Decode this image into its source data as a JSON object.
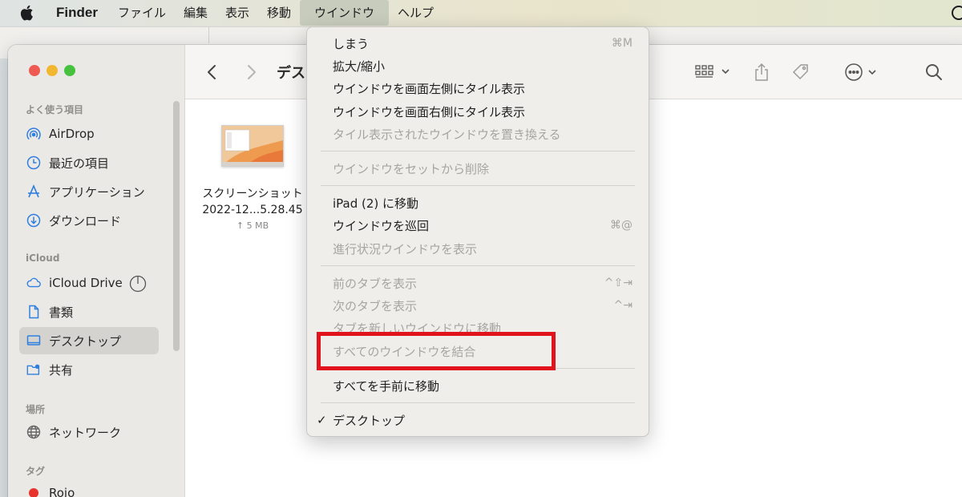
{
  "menubar": {
    "app_name": "Finder",
    "items": [
      "ファイル",
      "編集",
      "表示",
      "移動",
      "ウインドウ",
      "ヘルプ"
    ]
  },
  "toolbar": {
    "title": "デス"
  },
  "sidebar": {
    "favorites_label": "よく使う項目",
    "favorites": [
      "AirDrop",
      "最近の項目",
      "アプリケーション",
      "ダウンロード"
    ],
    "icloud_label": "iCloud",
    "icloud": [
      "iCloud Drive",
      "書類",
      "デスクトップ",
      "共有"
    ],
    "locations_label": "場所",
    "locations": [
      "ネットワーク"
    ],
    "tags_label": "タグ",
    "tags": [
      "Rojo"
    ],
    "selected": "デスクトップ",
    "tag_color": "#e8322c"
  },
  "file": {
    "name_line1": "スクリーンショット",
    "name_line2": "2022-12...5.28.45",
    "size": "↑ 5 MB"
  },
  "window_menu": {
    "items": [
      {
        "label": "しまう",
        "shortcut": "⌘M",
        "disabled": false
      },
      {
        "label": "拡大/縮小",
        "shortcut": "",
        "disabled": false
      },
      {
        "label": "ウインドウを画面左側にタイル表示",
        "shortcut": "",
        "disabled": false
      },
      {
        "label": "ウインドウを画面右側にタイル表示",
        "shortcut": "",
        "disabled": false
      },
      {
        "label": "タイル表示されたウインドウを置き換える",
        "shortcut": "",
        "disabled": true
      },
      {
        "label": "ウインドウをセットから削除",
        "shortcut": "",
        "disabled": true
      },
      {
        "label": "iPad (2) に移動",
        "shortcut": "",
        "disabled": false
      },
      {
        "label": "ウインドウを巡回",
        "shortcut": "⌘@",
        "disabled": false
      },
      {
        "label": "進行状況ウインドウを表示",
        "shortcut": "",
        "disabled": true
      },
      {
        "label": "前のタブを表示",
        "shortcut": "^⇧⇥",
        "disabled": true
      },
      {
        "label": "次のタブを表示",
        "shortcut": "^⇥",
        "disabled": true
      },
      {
        "label": "タブを新しいウインドウに移動",
        "shortcut": "",
        "disabled": true
      },
      {
        "label": "すべてのウインドウを結合",
        "shortcut": "",
        "disabled": true
      },
      {
        "label": "すべてを手前に移動",
        "shortcut": "",
        "disabled": false
      },
      {
        "label": "デスクトップ",
        "shortcut": "",
        "disabled": false,
        "checked": true
      }
    ],
    "check_mark": "✓"
  },
  "colors": {
    "highlight": "#e1141e",
    "menu_bg": "#f0eeea",
    "sidebar_bg": "#ebe9e6"
  }
}
